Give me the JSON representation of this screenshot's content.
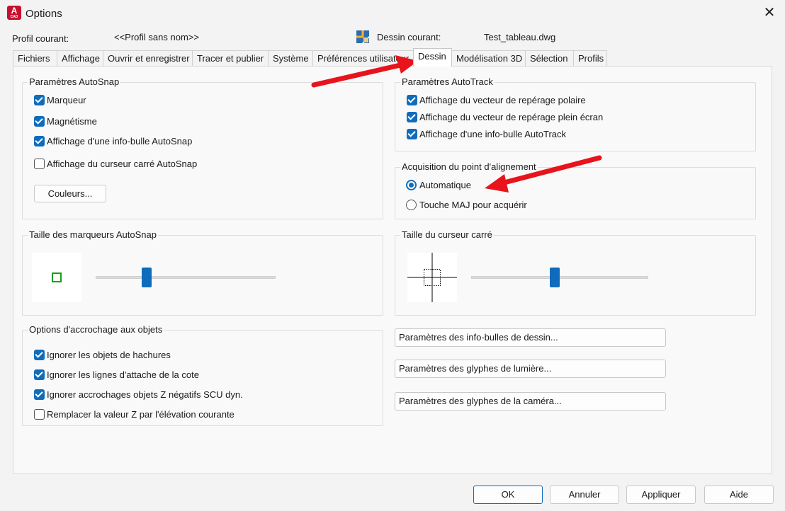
{
  "window": {
    "title": "Options",
    "close_symbol": "✕",
    "app_icon_letter": "A",
    "app_icon_sub": "CAD"
  },
  "header": {
    "profile_label": "Profil courant:",
    "profile_value": "<<Profil sans nom>>",
    "drawing_label": "Dessin courant:",
    "drawing_value": "Test_tableau.dwg"
  },
  "tabs": [
    {
      "label": "Fichiers"
    },
    {
      "label": "Affichage"
    },
    {
      "label": "Ouvrir et enregistrer"
    },
    {
      "label": "Tracer et publier"
    },
    {
      "label": "Système"
    },
    {
      "label": "Préférences utilisateur"
    },
    {
      "label": "Dessin",
      "active": true
    },
    {
      "label": "Modélisation 3D"
    },
    {
      "label": "Sélection"
    },
    {
      "label": "Profils"
    }
  ],
  "autosnap": {
    "title": "Paramètres AutoSnap",
    "marker": {
      "label": "Marqueur",
      "checked": true
    },
    "magnet": {
      "label": "Magnétisme",
      "checked": true
    },
    "tooltip": {
      "label": "Affichage d'une info-bulle AutoSnap",
      "checked": true
    },
    "aperture": {
      "label": "Affichage du curseur carré AutoSnap",
      "checked": false
    },
    "colors_button": "Couleurs..."
  },
  "autotrack": {
    "title": "Paramètres AutoTrack",
    "polar": {
      "label": "Affichage du vecteur de repérage polaire",
      "checked": true
    },
    "fullscreen": {
      "label": "Affichage du vecteur de repérage plein écran",
      "checked": true
    },
    "tooltip": {
      "label": "Affichage d'une info-bulle AutoTrack",
      "checked": true
    }
  },
  "alignment": {
    "title": "Acquisition du point d'alignement",
    "automatic": {
      "label": "Automatique",
      "selected": true
    },
    "shift": {
      "label": "Touche MAJ pour acquérir",
      "selected": false
    }
  },
  "marker_size": {
    "title": "Taille des marqueurs AutoSnap",
    "level": 0.27
  },
  "aperture_size": {
    "title": "Taille du curseur carré",
    "level": 0.47
  },
  "object_snap": {
    "title": "Options d'accrochage aux objets",
    "hatch": {
      "label": "Ignorer les objets de hachures",
      "checked": true
    },
    "dimension": {
      "label": "Ignorer les lignes d'attache de la cote",
      "checked": true
    },
    "negative_z": {
      "label": "Ignorer accrochages objets Z négatifs SCU dyn.",
      "checked": true
    },
    "replace_z": {
      "label": "Remplacer la valeur Z par l'élévation courante",
      "checked": false
    }
  },
  "buttons_right": {
    "tooltip_settings": "Paramètres des info-bulles de dessin...",
    "light_glyphs": "Paramètres des glyphes de lumière...",
    "camera_glyphs": "Paramètres des glyphes de la caméra..."
  },
  "footer": {
    "ok": "OK",
    "cancel": "Annuler",
    "apply": "Appliquer",
    "help": "Aide"
  },
  "colors": {
    "accent": "#0f6cbd",
    "annotation_arrow": "#e8141b",
    "marker_green": "#1a9e1a"
  }
}
